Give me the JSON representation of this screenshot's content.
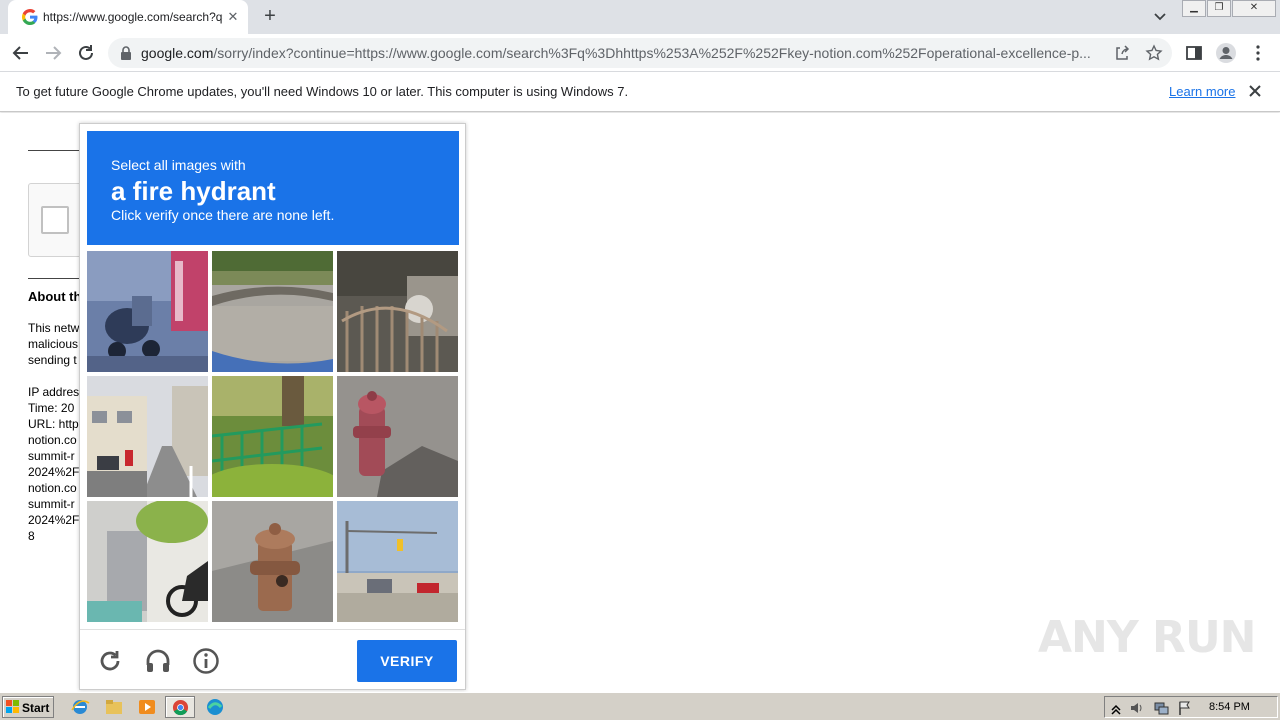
{
  "browser": {
    "tab_title": "https://www.google.com/search?q=",
    "url_host": "google.com",
    "url_path": "/sorry/index?continue=https://www.google.com/search%3Fq%3Dhhttps%253A%252F%252Fkey-notion.com%252Foperational-excellence-p..."
  },
  "infobar": {
    "message": "To get future Google Chrome updates, you'll need Windows 10 or later. This computer is using Windows 7.",
    "learn_more": "Learn more"
  },
  "page": {
    "about_heading": "About th",
    "para1": [
      "This netw",
      "malicious",
      "sending t"
    ],
    "para2": [
      "IP addres",
      "Time: 20",
      "URL: http",
      "notion.co",
      "summit-r",
      "2024%2F",
      "notion.co",
      "summit-r",
      "2024%2F",
      "8"
    ]
  },
  "captcha": {
    "instruction_line1": "Select all images with",
    "target_object": "a fire hydrant",
    "instruction_line3": "Click verify once there are none left.",
    "verify_label": "VERIFY",
    "accent_color": "#1a73e8"
  },
  "watermark": "ANY RUN",
  "taskbar": {
    "start_label": "Start",
    "clock": "8:54 PM"
  }
}
